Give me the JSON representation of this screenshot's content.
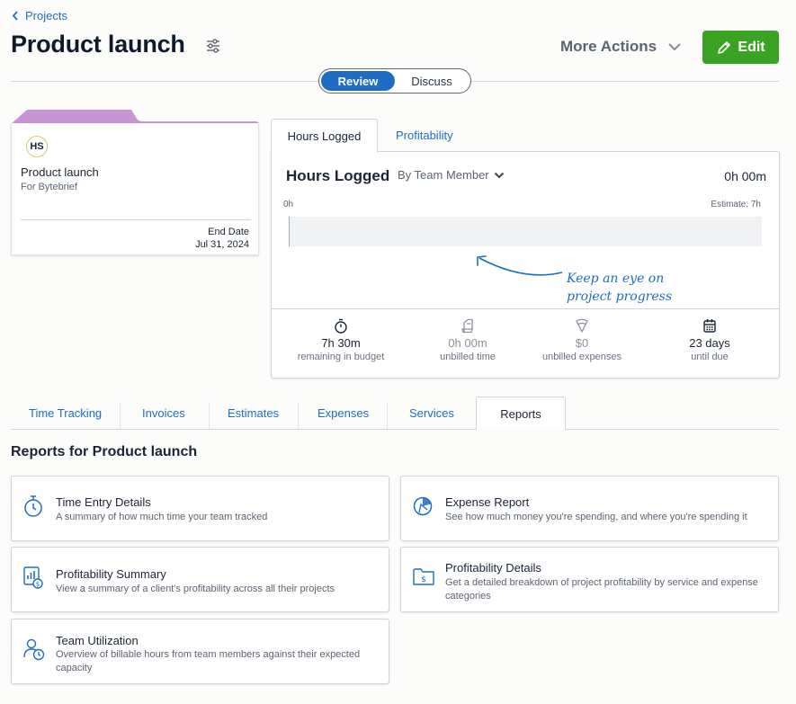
{
  "breadcrumb": {
    "label": "Projects"
  },
  "header": {
    "title": "Product launch",
    "more_actions": "More Actions",
    "edit": "Edit"
  },
  "toggle": {
    "active": "Review",
    "inactive": "Discuss"
  },
  "project_card": {
    "initials": "HS",
    "name": "Product launch",
    "client": "For Bytebrief",
    "end_label": "End Date",
    "end_date": "Jul 31, 2024",
    "tab_color": "#c994d3"
  },
  "hours_panel": {
    "tabs": [
      "Hours Logged",
      "Profitability"
    ],
    "title": "Hours Logged",
    "dropdown": "By Team Member",
    "total": "0h 00m",
    "scale_start": "0h",
    "estimate": "Estimate: 7h",
    "hint_line1": "Keep an eye on",
    "hint_line2": "project progress",
    "stats": [
      {
        "icon": "stopwatch-icon",
        "value": "7h 30m",
        "label": "remaining in budget"
      },
      {
        "icon": "invoice-icon",
        "value": "0h 00m",
        "label": "unbilled time"
      },
      {
        "icon": "receipt-icon",
        "value": "$0",
        "label": "unbilled expenses"
      },
      {
        "icon": "calendar-icon",
        "value": "23 days",
        "label": "until due"
      }
    ]
  },
  "tabs": [
    "Time Tracking",
    "Invoices",
    "Estimates",
    "Expenses",
    "Services",
    "Reports"
  ],
  "reports": {
    "title": "Reports for Product launch",
    "items": [
      {
        "title": "Time Entry Details",
        "desc": "A summary of how much time your team tracked",
        "icon": "stopwatch-icon"
      },
      {
        "title": "Expense Report",
        "desc": "See how much money you're spending, and where you're spending it",
        "icon": "expense-pie-icon"
      },
      {
        "title": "Profitability Summary",
        "desc": "View a summary of a client's profitability across all their projects",
        "icon": "chart-dollar-icon"
      },
      {
        "title": "Profitability Details",
        "desc": "Get a detailed breakdown of project profitability by service and expense categories",
        "icon": "folder-dollar-icon"
      },
      {
        "title": "Team Utilization",
        "desc": "Overview of billable hours from team members against their expected capacity",
        "icon": "team-clock-icon"
      }
    ]
  },
  "colors": {
    "accent": "#1f6cc4",
    "edit_green": "#3aa324"
  }
}
